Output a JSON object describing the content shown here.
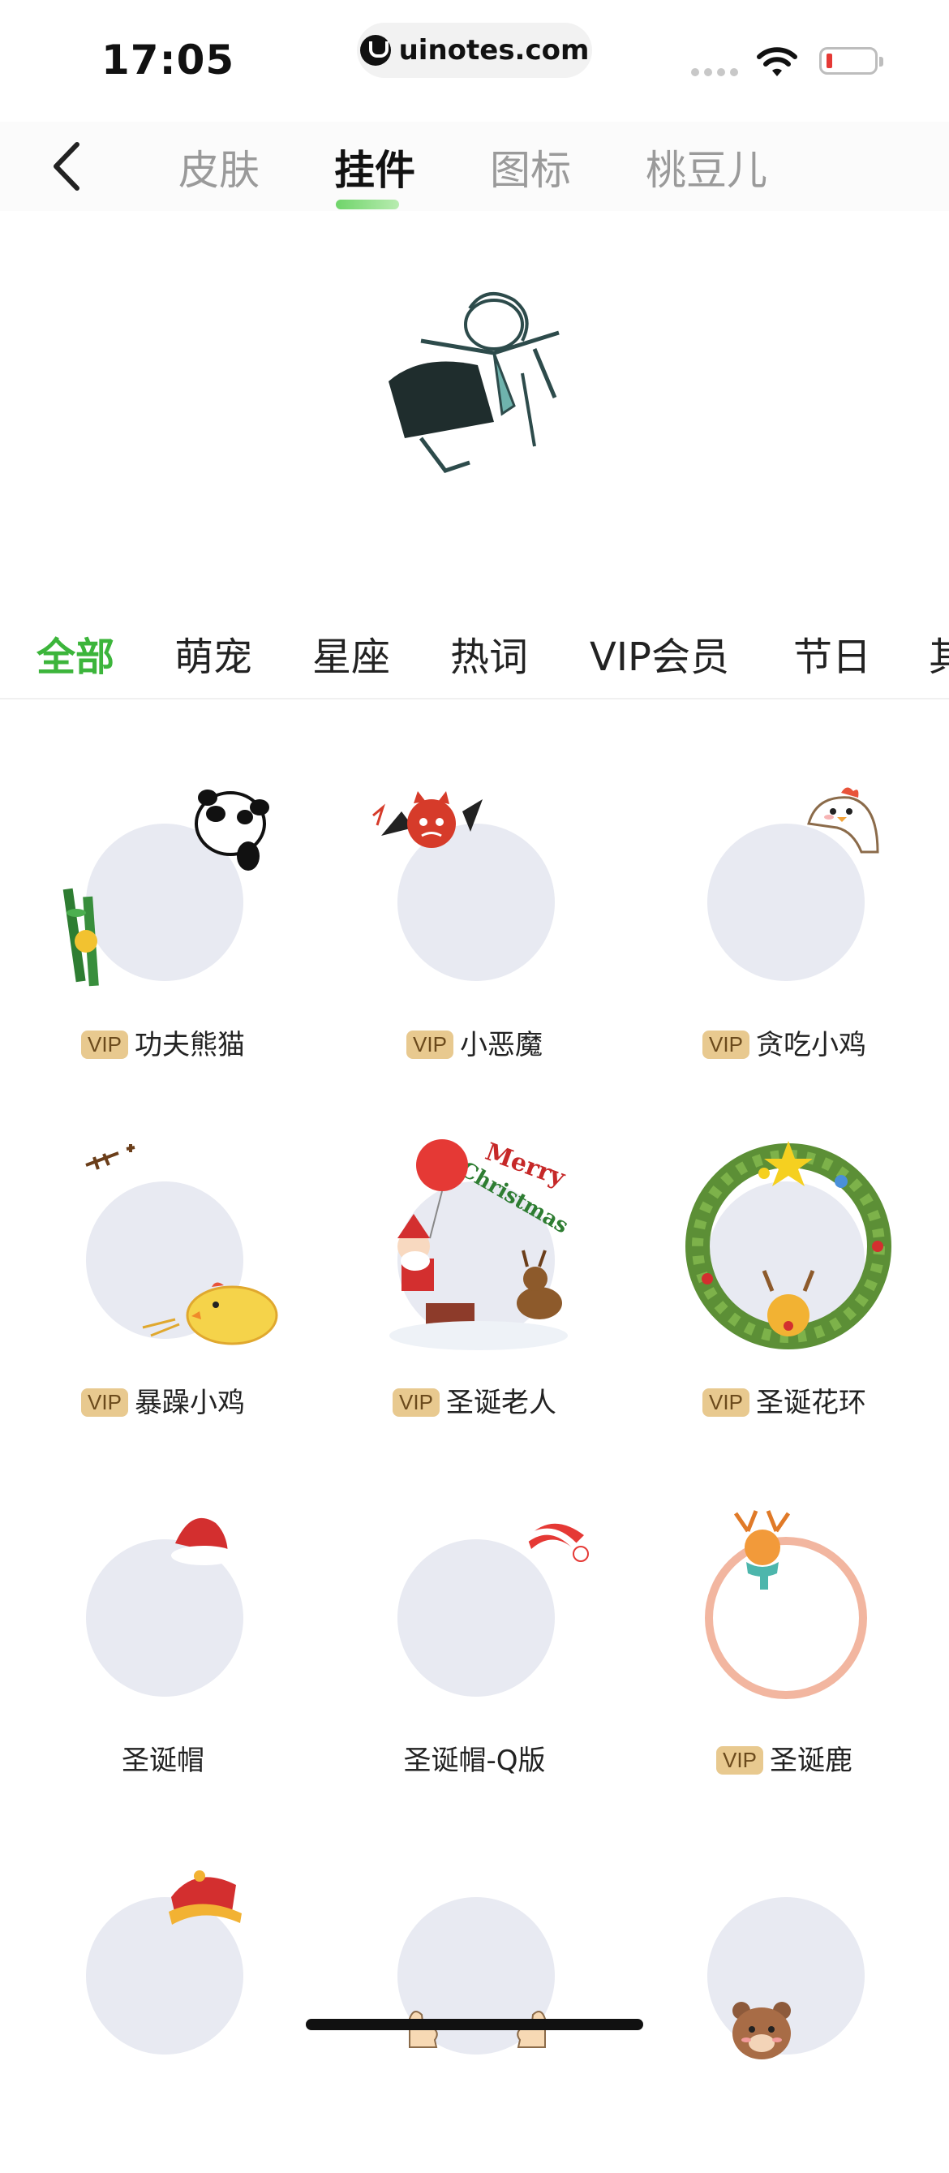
{
  "status_bar": {
    "time": "17:05",
    "url": "uinotes.com"
  },
  "top_tabs": [
    {
      "label": "皮肤",
      "active": false
    },
    {
      "label": "挂件",
      "active": true
    },
    {
      "label": "图标",
      "active": false
    },
    {
      "label": "桃豆儿",
      "active": false
    }
  ],
  "category_tabs": [
    {
      "label": "全部",
      "active": true
    },
    {
      "label": "萌宠",
      "active": false
    },
    {
      "label": "星座",
      "active": false
    },
    {
      "label": "热词",
      "active": false
    },
    {
      "label": "VIP会员",
      "active": false
    },
    {
      "label": "节日",
      "active": false
    },
    {
      "label": "其",
      "active": false
    }
  ],
  "vip_badge": "VIP",
  "items": [
    {
      "name": "功夫熊猫",
      "vip": true,
      "decoration": "panda-icon"
    },
    {
      "name": "小恶魔",
      "vip": true,
      "decoration": "devil-icon"
    },
    {
      "name": "贪吃小鸡",
      "vip": true,
      "decoration": "chick-icon"
    },
    {
      "name": "暴躁小鸡",
      "vip": true,
      "decoration": "angry-chick-icon"
    },
    {
      "name": "圣诞老人",
      "vip": true,
      "decoration": "santa-icon"
    },
    {
      "name": "圣诞花环",
      "vip": true,
      "decoration": "wreath-icon"
    },
    {
      "name": "圣诞帽",
      "vip": false,
      "decoration": "santa-hat-icon"
    },
    {
      "name": "圣诞帽-Q版",
      "vip": false,
      "decoration": "santa-hat-q-icon"
    },
    {
      "name": "圣诞鹿",
      "vip": true,
      "decoration": "reindeer-icon"
    },
    {
      "name": "",
      "vip": false,
      "decoration": "chinese-hat-icon"
    },
    {
      "name": "",
      "vip": false,
      "decoration": "thumbs-up-icon"
    },
    {
      "name": "",
      "vip": false,
      "decoration": "bear-icon"
    }
  ],
  "colors": {
    "accent": "#3cb53b",
    "placeholder_circle": "#e8eaf2",
    "vip_badge": "#e8c98f"
  }
}
